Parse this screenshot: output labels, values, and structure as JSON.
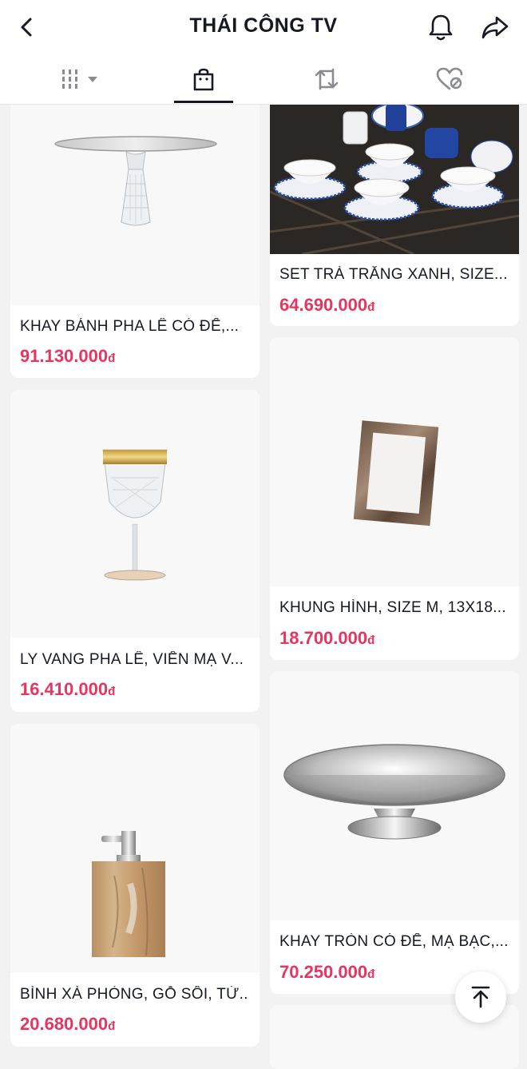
{
  "header": {
    "title": "THÁI CÔNG TV"
  },
  "icons": {
    "back": "chevron-left-icon",
    "bell": "bell-icon",
    "share": "share-icon",
    "grid": "grid-icon",
    "shop": "shopping-bag-icon",
    "repost": "repost-icon",
    "liked": "liked-hidden-icon",
    "to_top": "arrow-up-icon"
  },
  "colors": {
    "price": "#e8355f",
    "text": "#161823",
    "background": "#f2f2f2"
  },
  "products": [
    {
      "name": "KHAY BÁNH PHA LÊ CÓ ĐẾ,...",
      "price": "91.130.000",
      "currency": "đ"
    },
    {
      "name": "SET TRÀ TRẮNG XANH, SIZE...",
      "price": "64.690.000",
      "currency": "đ"
    },
    {
      "name": "LY VANG PHA LÊ, VIỀN MẠ V...",
      "price": "16.410.000",
      "currency": "đ"
    },
    {
      "name": "KHUNG HÌNH, SIZE M, 13X18...",
      "price": "18.700.000",
      "currency": "đ"
    },
    {
      "name": "BÌNH XÀ PHÒNG, GỖ SỒI, TỪ...",
      "price": "20.680.000",
      "currency": "đ"
    },
    {
      "name": "KHAY TRÒN CÓ ĐẾ, MẠ BẠC,...",
      "price": "70.250.000",
      "currency": "đ"
    }
  ]
}
